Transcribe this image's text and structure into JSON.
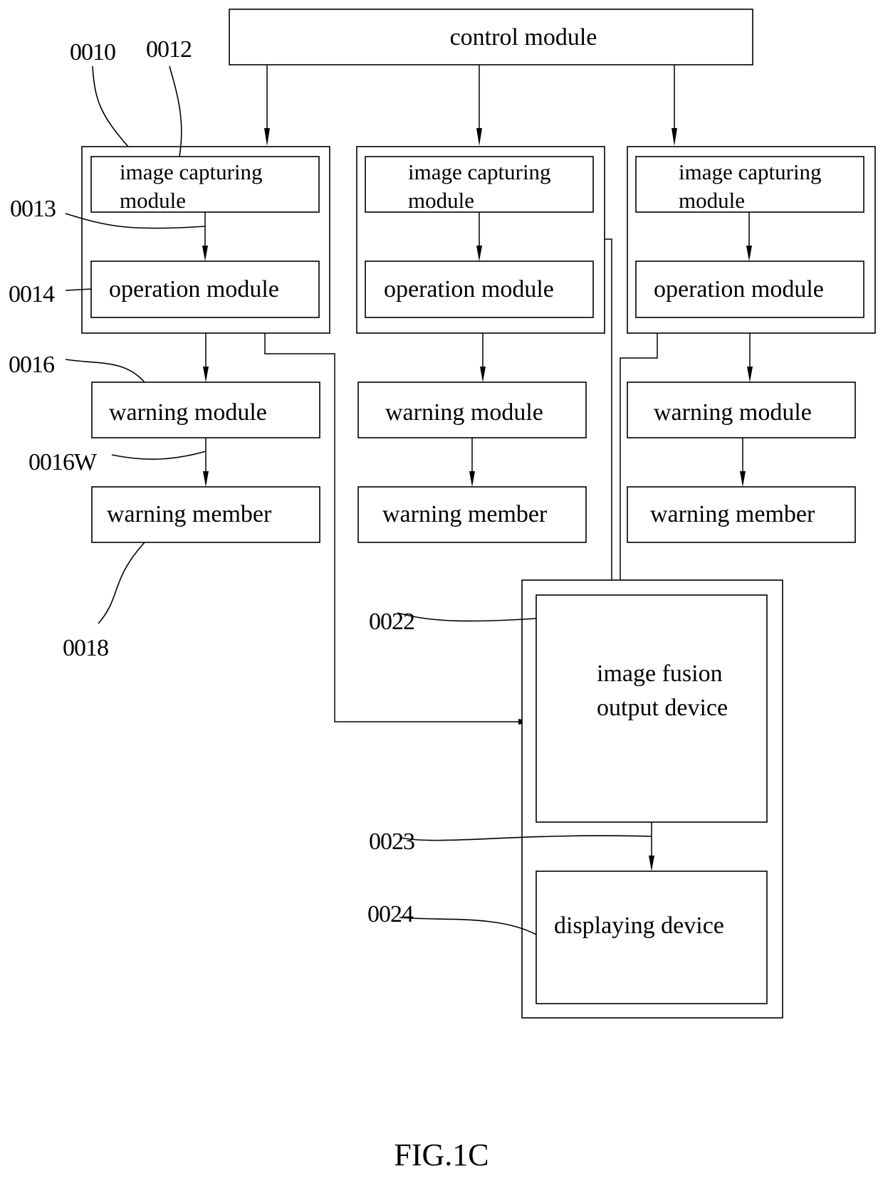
{
  "figure": {
    "caption": "FIG.1C",
    "control_module": "control module",
    "units": [
      {
        "capture_line1": "image capturing",
        "capture_line2": "module",
        "operation": "operation module",
        "warning_module": "warning module",
        "warning_member": "warning member"
      },
      {
        "capture_line1": "image capturing",
        "capture_line2": "module",
        "operation": "operation module",
        "warning_module": "warning module",
        "warning_member": "warning member"
      },
      {
        "capture_line1": "image capturing",
        "capture_line2": "module",
        "operation": "operation module",
        "warning_module": "warning module",
        "warning_member": "warning member"
      }
    ],
    "fusion_line1": "image fusion",
    "fusion_line2": "output device",
    "display": "displaying device",
    "refs": {
      "r0010": "0010",
      "r0012": "0012",
      "r0013": "0013",
      "r0014": "0014",
      "r0016": "0016",
      "r0016w": "0016W",
      "r0018": "0018",
      "r0022": "0022",
      "r0023": "0023",
      "r0024": "0024"
    }
  }
}
